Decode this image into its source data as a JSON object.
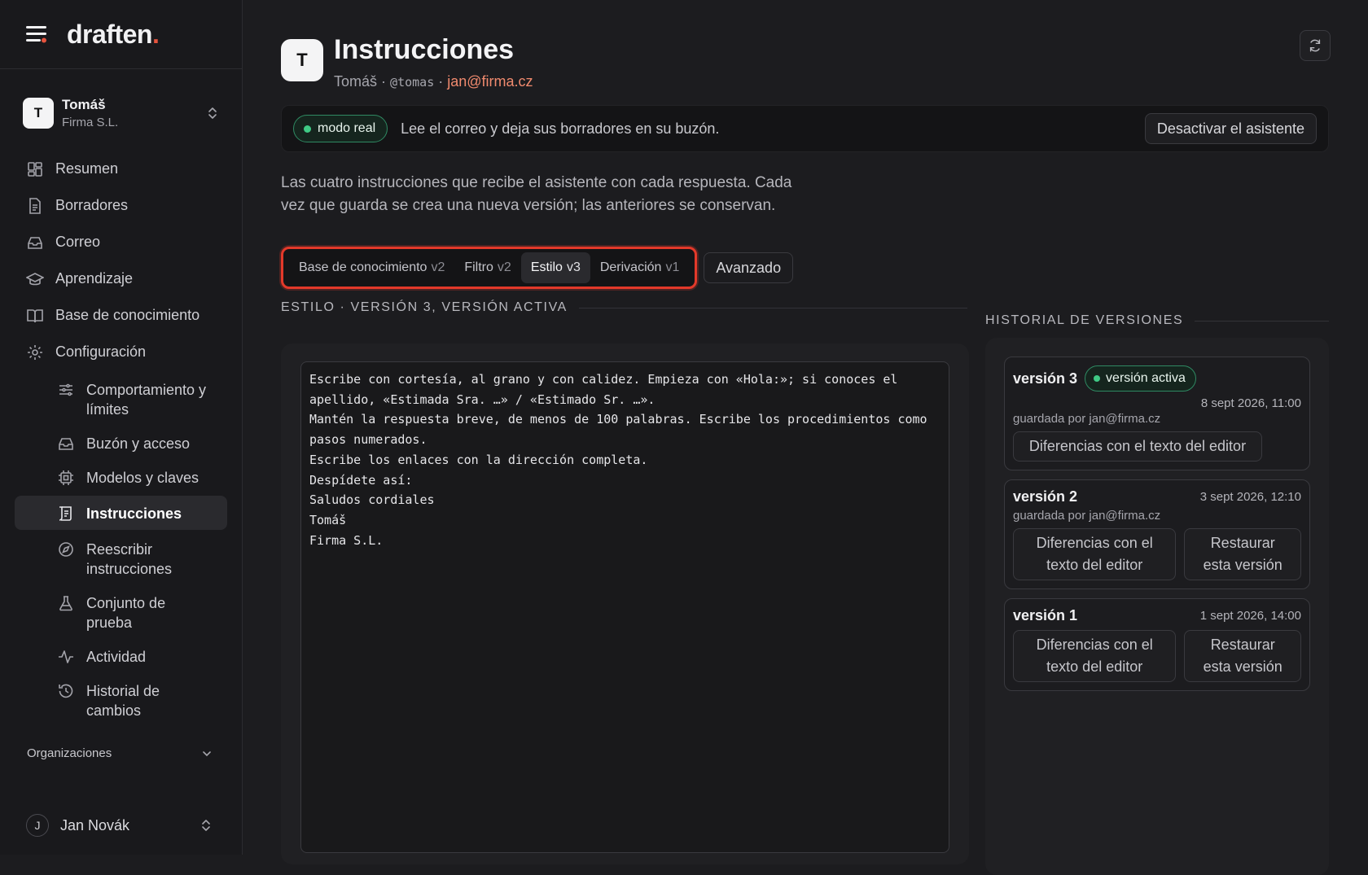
{
  "brand": {
    "logo_text": "draften",
    "logo_dot": "."
  },
  "account": {
    "initial": "T",
    "name": "Tomáš",
    "org": "Firma S.L."
  },
  "nav": {
    "items": [
      {
        "label": "Resumen",
        "icon": "grid-icon"
      },
      {
        "label": "Borradores",
        "icon": "file-icon"
      },
      {
        "label": "Correo",
        "icon": "inbox-icon"
      },
      {
        "label": "Aprendizaje",
        "icon": "graduation-cap-icon"
      },
      {
        "label": "Base de conocimiento",
        "icon": "book-icon"
      },
      {
        "label": "Configuración",
        "icon": "gear-icon"
      }
    ],
    "sub_items": [
      {
        "label": "Comportamiento y límites",
        "icon": "sliders-icon"
      },
      {
        "label": "Buzón y acceso",
        "icon": "inbox-icon"
      },
      {
        "label": "Modelos y claves",
        "icon": "chip-icon"
      },
      {
        "label": "Instrucciones",
        "icon": "scroll-icon",
        "active": true
      },
      {
        "label": "Reescribir instrucciones",
        "icon": "compass-icon"
      },
      {
        "label": "Conjunto de prueba",
        "icon": "flask-icon"
      },
      {
        "label": "Actividad",
        "icon": "activity-icon"
      },
      {
        "label": "Historial de cambios",
        "icon": "history-icon"
      }
    ],
    "orgs_label": "Organizaciones"
  },
  "user": {
    "initial": "J",
    "name": "Jan Novák"
  },
  "header": {
    "initial": "T",
    "title": "Instrucciones",
    "user_name": "Tomáš",
    "sep": "·",
    "handle": "@tomas",
    "email": "jan@firma.cz"
  },
  "status": {
    "badge": "modo real",
    "text": "Lee el correo y deja sus borradores en su buzón.",
    "button": "Desactivar el asistente"
  },
  "description": "Las cuatro instrucciones que recibe el asistente con cada respuesta. Cada vez que guarda se crea una nueva versión; las anteriores se conservan.",
  "tabs": [
    {
      "label": "Base de conocimiento",
      "version": "v2"
    },
    {
      "label": "Filtro",
      "version": "v2"
    },
    {
      "label": "Estilo",
      "version": "v3",
      "active": true
    },
    {
      "label": "Derivación",
      "version": "v1"
    }
  ],
  "advanced_label": "Avanzado",
  "section_title": "ESTILO · VERSIÓN 3, VERSIÓN ACTIVA",
  "editor_text": "Escribe con cortesía, al grano y con calidez. Empieza con «Hola:»; si conoces el apellido, «Estimada Sra. …» / «Estimado Sr. …».\nMantén la respuesta breve, de menos de 100 palabras. Escribe los procedimientos como pasos numerados.\nEscribe los enlaces con la dirección completa.\nDespídete así:\nSaludos cordiales\nTomáš\nFirma S.L.",
  "history": {
    "title": "HISTORIAL DE VERSIONES",
    "versions": [
      {
        "name": "versión 3",
        "badge": "versión activa",
        "date": "8 sept 2026, 11:00",
        "by": "guardada por jan@firma.cz",
        "diff": "Diferencias con el texto del editor"
      },
      {
        "name": "versión 2",
        "date": "3 sept 2026, 12:10",
        "by": "guardada por jan@firma.cz",
        "diff": "Diferencias con el texto del editor",
        "restore": "Restaurar esta versión"
      },
      {
        "name": "versión 1",
        "date": "1 sept 2026, 14:00",
        "diff": "Diferencias con el texto del editor",
        "restore": "Restaurar esta versión"
      }
    ]
  },
  "colors": {
    "accent_red": "#e3392a",
    "status_green": "#3fca85",
    "email_orange": "#f08a6e"
  }
}
